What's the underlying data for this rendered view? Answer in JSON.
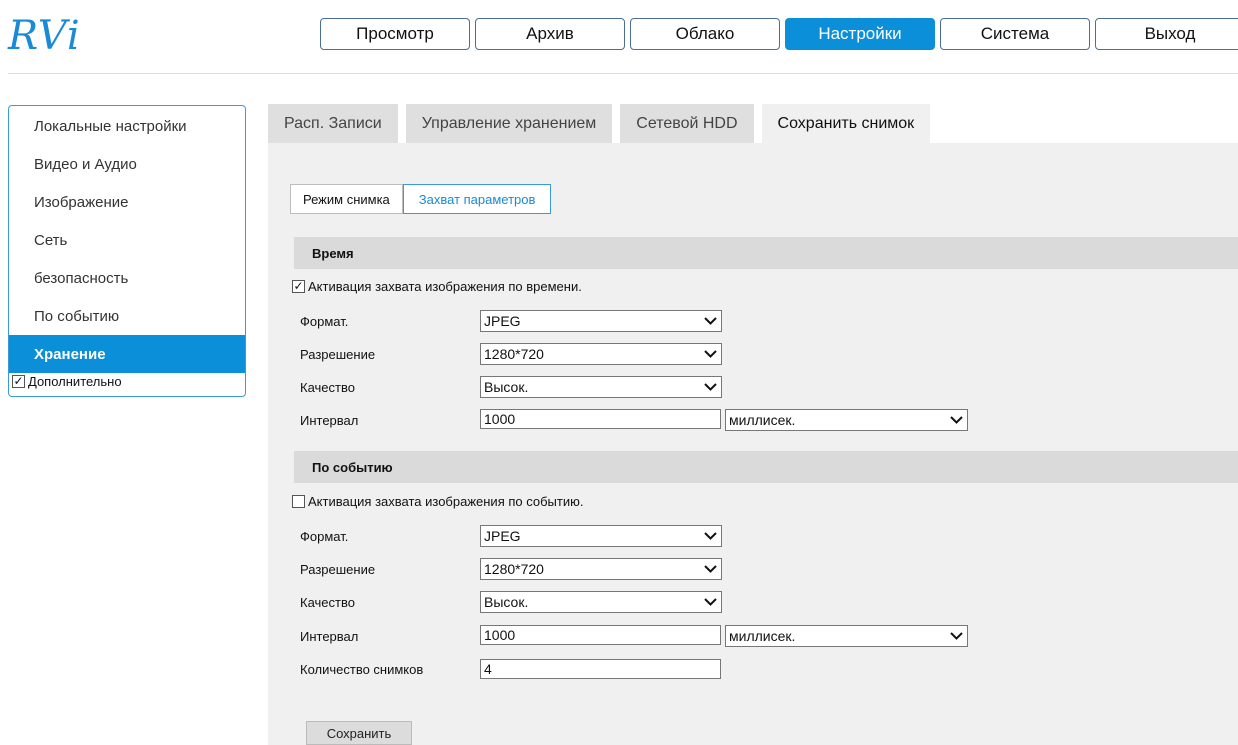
{
  "logo": "RVi",
  "nav": [
    "Просмотр",
    "Архив",
    "Облако",
    "Настройки",
    "Система",
    "Выход"
  ],
  "sidebar": {
    "items": [
      "Локальные настройки",
      "Видео и Аудио",
      "Изображение",
      "Сеть",
      "безопасность",
      "По событию",
      "Хранение"
    ],
    "extra_label": "Дополнительно",
    "extra_checked": true
  },
  "tabs": [
    "Расп. Записи",
    "Управление хранением",
    "Сетевой HDD",
    "Сохранить снимок"
  ],
  "subtabs": [
    "Режим снимка",
    "Захват параметров"
  ],
  "timing": {
    "header": "Время",
    "enable_label": "Активация захвата изображения по времени.",
    "enable_checked": true,
    "format_label": "Формат.",
    "format_value": "JPEG",
    "resolution_label": "Разрешение",
    "resolution_value": "1280*720",
    "quality_label": "Качество",
    "quality_value": "Высок.",
    "interval_label": "Интервал",
    "interval_value": "1000",
    "interval_unit": "миллисек."
  },
  "event": {
    "header": "По событию",
    "enable_label": "Активация захвата изображения по событию.",
    "enable_checked": false,
    "format_label": "Формат.",
    "format_value": "JPEG",
    "resolution_label": "Разрешение",
    "resolution_value": "1280*720",
    "quality_label": "Качество",
    "quality_value": "Высок.",
    "interval_label": "Интервал",
    "interval_value": "1000",
    "interval_unit": "миллисек.",
    "count_label": "Количество снимков",
    "count_value": "4"
  },
  "save_label": "Сохранить",
  "colors": {
    "accent": "#0a8fd8",
    "logo": "#1a8ad4",
    "content_bg": "#f0f0f0",
    "section_header_bg": "#dadada"
  }
}
